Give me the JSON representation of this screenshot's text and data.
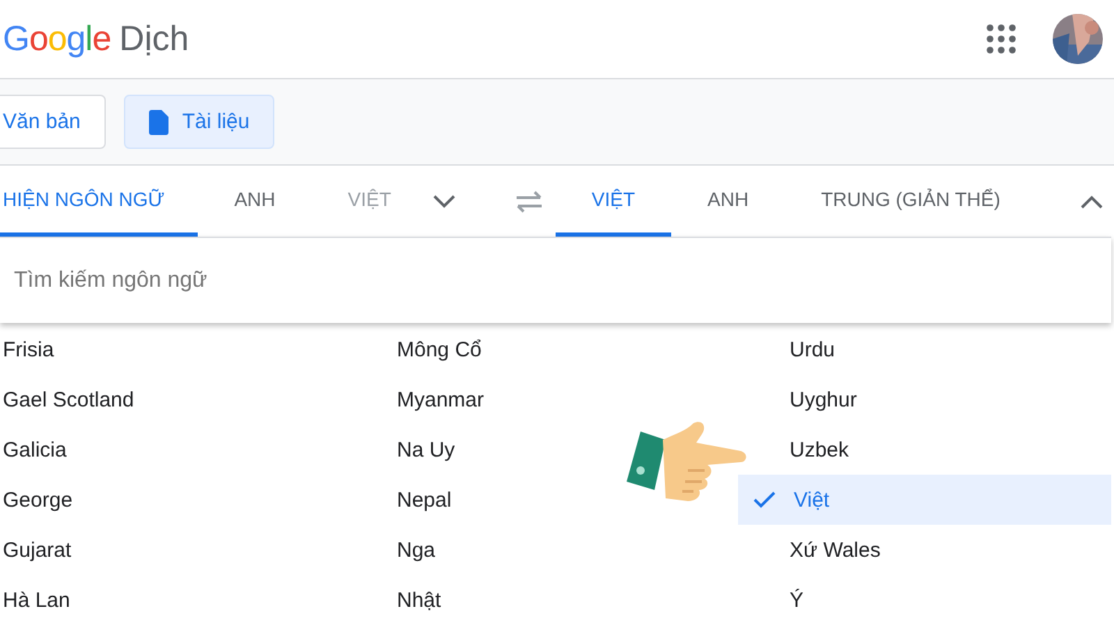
{
  "header": {
    "logo": "Google",
    "title": "Dịch"
  },
  "mode_buttons": [
    {
      "label": "Văn bản",
      "selected": false
    },
    {
      "label": "Tài liệu",
      "selected": true
    }
  ],
  "source_tabs": [
    {
      "label": "HIỆN NGÔN NGỮ",
      "selected": true
    },
    {
      "label": "ANH",
      "selected": false
    },
    {
      "label": "VIỆT",
      "selected": false
    }
  ],
  "target_tabs": [
    {
      "label": "VIỆT",
      "selected": true
    },
    {
      "label": "ANH",
      "selected": false
    },
    {
      "label": "TRUNG (GIẢN THỂ)",
      "selected": false
    }
  ],
  "search": {
    "placeholder": "Tìm kiếm ngôn ngữ"
  },
  "language_columns": [
    [
      {
        "name": "Frisia",
        "selected": false
      },
      {
        "name": "Gael Scotland",
        "selected": false
      },
      {
        "name": "Galicia",
        "selected": false
      },
      {
        "name": "George",
        "selected": false
      },
      {
        "name": "Gujarat",
        "selected": false
      },
      {
        "name": "Hà Lan",
        "selected": false
      }
    ],
    [
      {
        "name": "Mông Cổ",
        "selected": false
      },
      {
        "name": "Myanmar",
        "selected": false
      },
      {
        "name": "Na Uy",
        "selected": false
      },
      {
        "name": "Nepal",
        "selected": false
      },
      {
        "name": "Nga",
        "selected": false
      },
      {
        "name": "Nhật",
        "selected": false
      }
    ],
    [
      {
        "name": "Urdu",
        "selected": false
      },
      {
        "name": "Uyghur",
        "selected": false
      },
      {
        "name": "Uzbek",
        "selected": false
      },
      {
        "name": "Việt",
        "selected": true
      },
      {
        "name": "Xứ Wales",
        "selected": false
      },
      {
        "name": "Ý",
        "selected": false
      }
    ]
  ]
}
